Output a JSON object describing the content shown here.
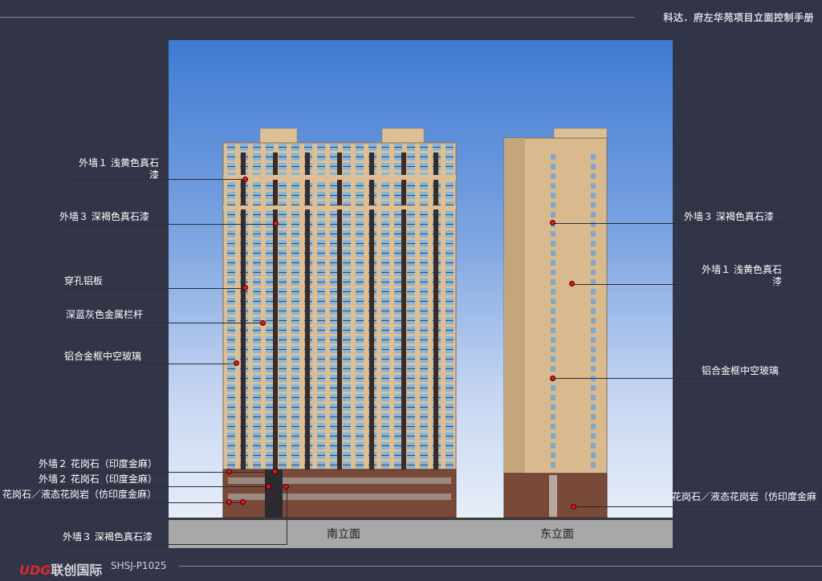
{
  "header": {
    "title": "科达．府左华苑项目立面控制手册"
  },
  "footer": {
    "brand_mark": "UDG",
    "brand_name": "联创国际",
    "code": "SHSJ-P1025"
  },
  "elevations": {
    "south": "南立面",
    "east": "东立面"
  },
  "annotations_left": [
    {
      "id": "wall1",
      "text": "外墙１  浅黄色真石\n漆"
    },
    {
      "id": "wall3",
      "text": "外墙３  深褐色真石漆"
    },
    {
      "id": "alum_panel",
      "text": "穿孔铝板"
    },
    {
      "id": "railing",
      "text": "深蓝灰色金属栏杆"
    },
    {
      "id": "glass",
      "text": "铝合金框中空玻璃"
    },
    {
      "id": "granite1",
      "text": "外墙２  花岗石（印度金麻）"
    },
    {
      "id": "granite2",
      "text": "外墙２  花岗石（印度金麻）"
    },
    {
      "id": "granite3",
      "text": "花岗石／液态花岗岩（仿印度金麻）"
    },
    {
      "id": "wall3b",
      "text": "外墙３  深褐色真石漆"
    }
  ],
  "annotations_right": [
    {
      "id": "r_wall3",
      "text": "外墙３  深褐色真石漆"
    },
    {
      "id": "r_wall1",
      "text": "外墙１  浅黄色真石\n漆"
    },
    {
      "id": "r_glass",
      "text": "铝合金框中空玻璃"
    },
    {
      "id": "r_granite",
      "text": "花岗石／液态花岗岩（仿印度金麻"
    }
  ],
  "colors": {
    "background": "#323548",
    "marker": "#e01818",
    "wall_light": "#dcbf94",
    "wall_dark": "#6b3f2e",
    "glass": "#7fb0d8"
  }
}
